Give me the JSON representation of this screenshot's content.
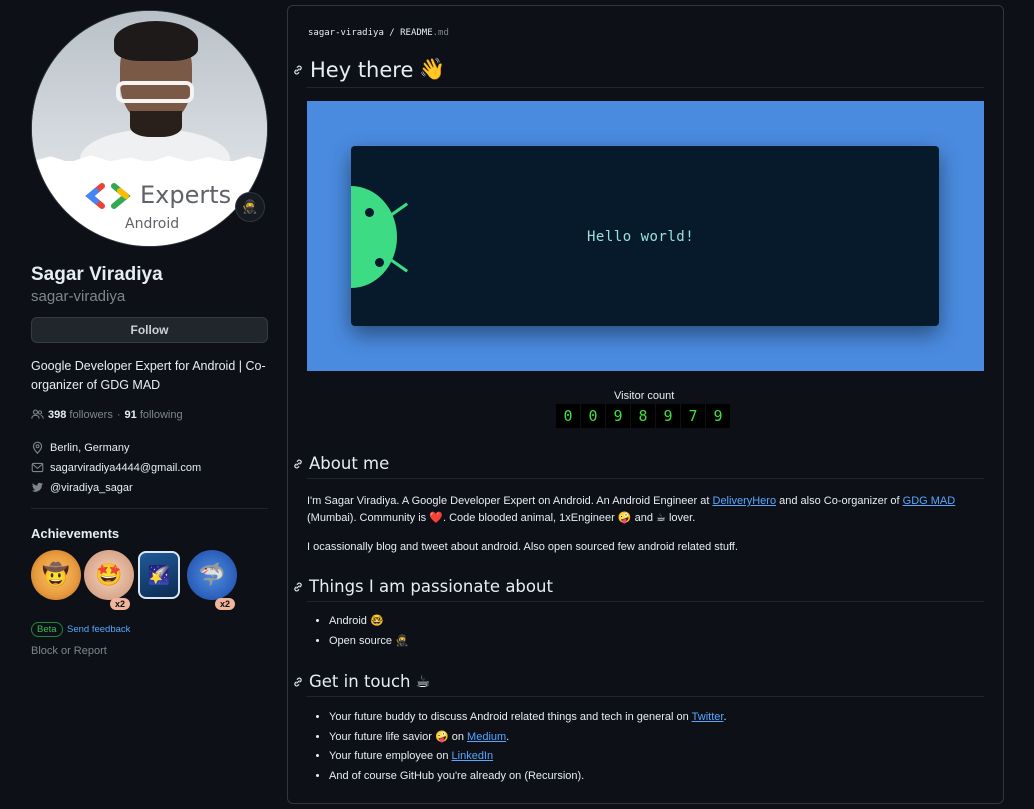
{
  "profile": {
    "name": "Sagar Viradiya",
    "login": "sagar-viradiya",
    "follow_label": "Follow",
    "bio": "Google Developer Expert for Android | Co-organizer of GDG MAD",
    "followers_count": "398",
    "followers_label": "followers",
    "separator": "·",
    "following_count": "91",
    "following_label": "following",
    "location": "Berlin, Germany",
    "email": "sagarviradiya4444@gmail.com",
    "twitter": "@viradiya_sagar",
    "avatar_card": {
      "title": "Experts",
      "subtitle": "Android"
    },
    "status_emoji": "🥷"
  },
  "achievements": {
    "title": "Achievements",
    "badges": [
      {
        "icon": "cowboy-emoji-icon",
        "count": ""
      },
      {
        "icon": "starstruck-emoji-icon",
        "count": "x2"
      },
      {
        "icon": "arctic-vault-icon",
        "count": ""
      },
      {
        "icon": "shark-icon",
        "count": "x2"
      }
    ],
    "beta_label": "Beta",
    "feedback_label": "Send feedback",
    "block_label": "Block or Report"
  },
  "readme": {
    "path_user": "sagar-viradiya",
    "path_sep": "/",
    "path_file": "README",
    "path_ext": ".md",
    "heading": "Hey there",
    "heading_emoji": "👋",
    "banner_text": "Hello world!",
    "visitor_label": "Visitor count",
    "visitor_digits": [
      "0",
      "0",
      "9",
      "8",
      "9",
      "7",
      "9"
    ],
    "about": {
      "heading": "About me",
      "p1_a": "I'm Sagar Viradiya. A Google Developer Expert on Android. An Android Engineer at ",
      "p1_link1": "DeliveryHero",
      "p1_b": " and also Co-organizer of ",
      "p1_link2": "GDG MAD",
      "p1_c": " (Mumbai). Community is ",
      "p1_heart": "❤️",
      "p1_d": ". Code blooded animal, 1xEngineer ",
      "p1_emoji1": "🤪",
      "p1_e": " and ",
      "p1_emoji2": "☕",
      "p1_f": " lover.",
      "p2": "I ocassionally blog and tweet about android. Also open sourced few android related stuff."
    },
    "passion": {
      "heading": "Things I am passionate about",
      "items": [
        {
          "text": "Android",
          "emoji": "🤓"
        },
        {
          "text": "Open source",
          "emoji": "🥷"
        }
      ]
    },
    "touch": {
      "heading": "Get in touch",
      "heading_emoji": "☕",
      "i1_text": "Your future buddy to discuss Android related things and tech in general on ",
      "i1_link": "Twitter",
      "i1_end": ".",
      "i2_text": "Your future life savior ",
      "i2_emoji": "🤪",
      "i2_mid": " on ",
      "i2_link": "Medium",
      "i2_end": ".",
      "i3_text": "Your future employee on ",
      "i3_link": "LinkedIn",
      "i4_text": "And of course GitHub you're already on (Recursion)."
    }
  }
}
